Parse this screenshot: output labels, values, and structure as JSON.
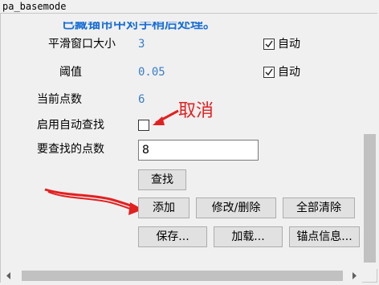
{
  "window": {
    "title": "pa_basemode"
  },
  "notice_text": "已藏锚帘中对手稍后处理。",
  "fields": {
    "smooth_window": {
      "label": "平滑窗口大小",
      "value": "3",
      "auto_label": "自动",
      "auto_checked": true
    },
    "threshold": {
      "label": "阈值",
      "value": "0.05",
      "auto_label": "自动",
      "auto_checked": true
    },
    "current_points": {
      "label": "当前点数",
      "value": "6"
    },
    "enable_auto_search": {
      "label": "启用自动查找",
      "checked": false
    },
    "points_to_find": {
      "label": "要查找的点数",
      "value": "8"
    }
  },
  "buttons": {
    "search": "查找",
    "add": "添加",
    "edit_delete": "修改/删除",
    "clear_all": "全部清除",
    "save": "保存...",
    "load": "加载...",
    "anchor_info": "锚点信息..."
  },
  "annotation": {
    "text": "取消",
    "color": "#e32020"
  },
  "colors": {
    "value_blue": "#3a7ec8",
    "notice_blue": "#1a6fd6",
    "annotation_red": "#e32020"
  }
}
